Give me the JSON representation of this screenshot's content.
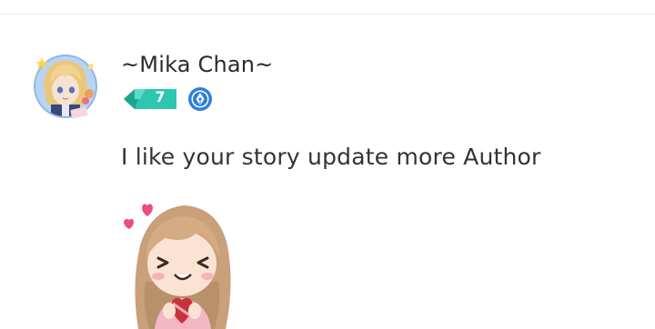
{
  "comment": {
    "author": "~Mika Chan~",
    "level": "7",
    "text": "I like your story update more Author",
    "avatar_icon": "anime-avatar-icon",
    "level_icon": "level-badge-icon",
    "title_icon": "pen-nib-badge-icon",
    "sticker_icon": "anime-girl-heart-sticker",
    "colors": {
      "level_badge": "#2ec6b0",
      "pen_badge": "#2f7fd8",
      "text": "#333333"
    }
  }
}
